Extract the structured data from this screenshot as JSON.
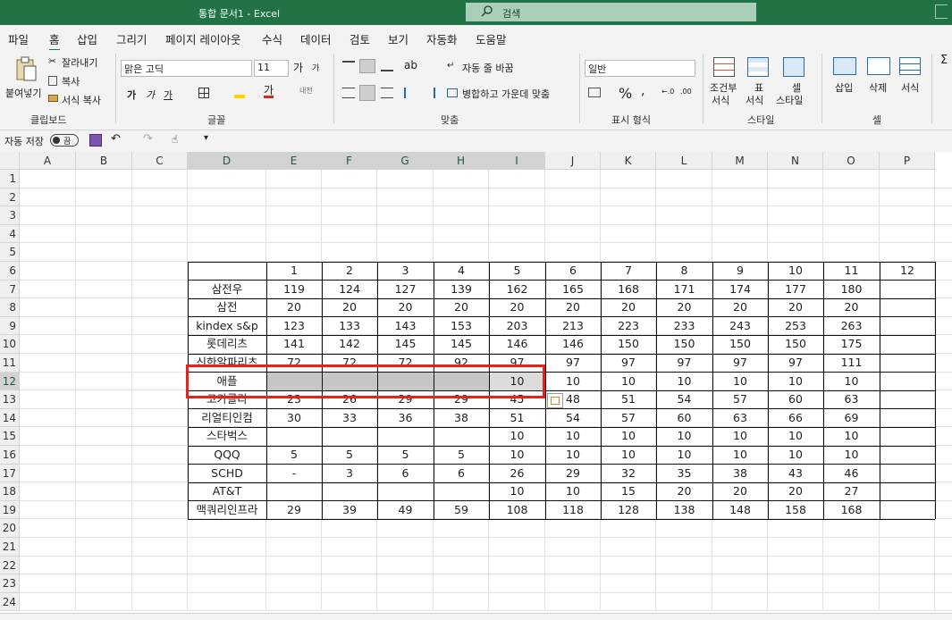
{
  "app": {
    "title": "통합 문서1  -  Excel",
    "search_placeholder": "검색",
    "search_icon": "search-icon"
  },
  "tabs": [
    "파일",
    "홈",
    "삽입",
    "그리기",
    "페이지 레이아웃",
    "수식",
    "데이터",
    "검토",
    "보기",
    "자동화",
    "도움말"
  ],
  "active_tab": "홈",
  "ribbon": {
    "clipboard": {
      "paste": "붙여넣기",
      "cut": "잘라내기",
      "copy": "복사",
      "format_painter": "서식 복사",
      "group": "클립보드"
    },
    "font": {
      "name": "맑은 고딕",
      "size": "11",
      "grow": "가",
      "shrink": "가",
      "bold": "가",
      "italic": "가",
      "underline": "가",
      "font_color_glyph": "가",
      "phonetic": "내천",
      "group": "글꼴"
    },
    "alignment": {
      "wrap": "자동 줄 바꿈",
      "merge": "병합하고 가운데 맞춤",
      "group": "맞춤"
    },
    "number": {
      "format": "일반",
      "percent": "%",
      "group": "표시 형식"
    },
    "styles": {
      "conditional_l1": "조건부",
      "conditional_l2": "서식",
      "table_l1": "표",
      "table_l2": "서식",
      "cell_l1": "셀",
      "cell_l2": "스타일",
      "group": "스타일"
    },
    "cells": {
      "insert": "삽입",
      "delete": "삭제",
      "format": "서식",
      "group": "셀"
    },
    "accent_color": "#217346"
  },
  "qat": {
    "autosave": "자동 저장",
    "toggle": "끔"
  },
  "sheet": {
    "columns": [
      "A",
      "B",
      "C",
      "D",
      "E",
      "F",
      "G",
      "H",
      "I",
      "J",
      "K",
      "L",
      "M",
      "N",
      "O",
      "P"
    ],
    "rows": [
      "1",
      "2",
      "3",
      "4",
      "5",
      "6",
      "7",
      "8",
      "9",
      "10",
      "11",
      "12",
      "13",
      "14",
      "15",
      "16",
      "17",
      "18",
      "19",
      "20",
      "21",
      "22",
      "23",
      "24"
    ],
    "selected_row": "12",
    "selected_columns": [
      "D",
      "E",
      "F",
      "G",
      "H",
      "I"
    ],
    "header_row": [
      "",
      "1",
      "2",
      "3",
      "4",
      "5",
      "6",
      "7",
      "8",
      "9",
      "10",
      "11",
      "12"
    ],
    "table": [
      [
        "삼전우",
        "119",
        "124",
        "127",
        "139",
        "162",
        "165",
        "168",
        "171",
        "174",
        "177",
        "180",
        ""
      ],
      [
        "삼전",
        "20",
        "20",
        "20",
        "20",
        "20",
        "20",
        "20",
        "20",
        "20",
        "20",
        "20",
        ""
      ],
      [
        "kindex s&p",
        "123",
        "133",
        "143",
        "153",
        "203",
        "213",
        "223",
        "233",
        "243",
        "253",
        "263",
        ""
      ],
      [
        "롯데리츠",
        "141",
        "142",
        "145",
        "145",
        "146",
        "146",
        "150",
        "150",
        "150",
        "150",
        "175",
        ""
      ],
      [
        "신한알파리츠",
        "72",
        "72",
        "72",
        "92",
        "97",
        "97",
        "97",
        "97",
        "97",
        "97",
        "111",
        ""
      ],
      [
        "애플",
        "",
        "",
        "",
        "",
        "10",
        "10",
        "10",
        "10",
        "10",
        "10",
        "10",
        ""
      ],
      [
        "코카콜라",
        "23",
        "26",
        "29",
        "29",
        "45",
        "48",
        "51",
        "54",
        "57",
        "60",
        "63",
        ""
      ],
      [
        "리얼티인컴",
        "30",
        "33",
        "36",
        "38",
        "51",
        "54",
        "57",
        "60",
        "63",
        "66",
        "69",
        ""
      ],
      [
        "스타벅스",
        "",
        "",
        "",
        "",
        "10",
        "10",
        "10",
        "10",
        "10",
        "10",
        "10",
        ""
      ],
      [
        "QQQ",
        "5",
        "5",
        "5",
        "5",
        "10",
        "10",
        "10",
        "10",
        "10",
        "10",
        "10",
        ""
      ],
      [
        "SCHD",
        "-",
        "3",
        "6",
        "6",
        "26",
        "29",
        "32",
        "35",
        "38",
        "43",
        "46",
        ""
      ],
      [
        "AT&T",
        "",
        "",
        "",
        "",
        "10",
        "10",
        "15",
        "20",
        "20",
        "20",
        "27",
        ""
      ],
      [
        "맥쿼리인프라",
        "29",
        "39",
        "49",
        "59",
        "108",
        "118",
        "128",
        "138",
        "148",
        "158",
        "168",
        ""
      ]
    ],
    "highlight_color": "#e8211d",
    "selection_color": "#c6c6c6"
  }
}
